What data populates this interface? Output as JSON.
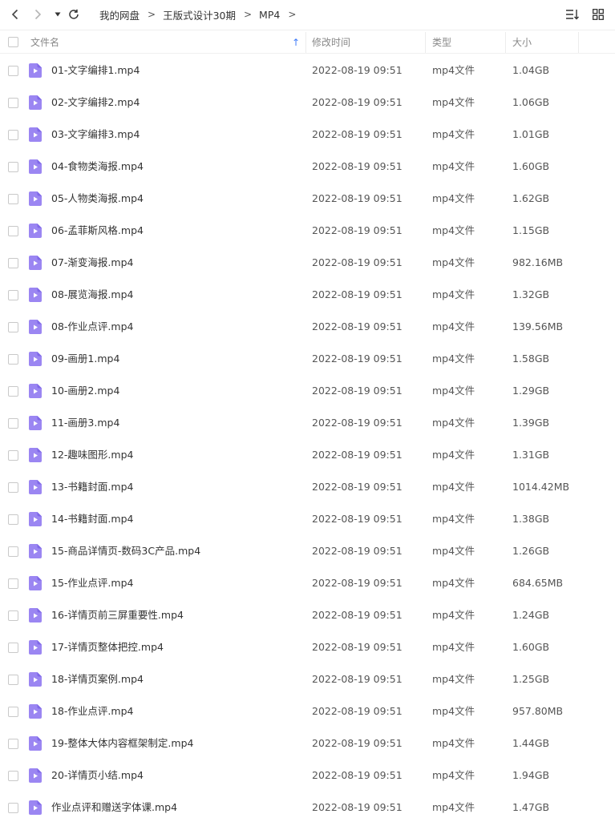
{
  "toolbar": {
    "back_icon": "chevron-left-icon",
    "forward_icon": "chevron-right-icon",
    "history_icon": "caret-down-icon",
    "refresh_icon": "refresh-icon",
    "sort_icon": "sort-list-icon",
    "view_icon": "grid-view-icon"
  },
  "breadcrumb": {
    "items": [
      "我的网盘",
      "王版式设计30期",
      "MP4"
    ],
    "separator": ">"
  },
  "columns": {
    "name": "文件名",
    "modified": "修改时间",
    "type": "类型",
    "size": "大小",
    "sort_indicator": "↑"
  },
  "colors": {
    "accent": "#3e7bfa",
    "video_icon": "#9b86f2",
    "video_icon_dark": "#7f68e8"
  },
  "files": [
    {
      "name": "01-文字编排1.mp4",
      "modified": "2022-08-19 09:51",
      "type": "mp4文件",
      "size": "1.04GB"
    },
    {
      "name": "02-文字编排2.mp4",
      "modified": "2022-08-19 09:51",
      "type": "mp4文件",
      "size": "1.06GB"
    },
    {
      "name": "03-文字编排3.mp4",
      "modified": "2022-08-19 09:51",
      "type": "mp4文件",
      "size": "1.01GB"
    },
    {
      "name": "04-食物类海报.mp4",
      "modified": "2022-08-19 09:51",
      "type": "mp4文件",
      "size": "1.60GB"
    },
    {
      "name": "05-人物类海报.mp4",
      "modified": "2022-08-19 09:51",
      "type": "mp4文件",
      "size": "1.62GB"
    },
    {
      "name": "06-孟菲斯风格.mp4",
      "modified": "2022-08-19 09:51",
      "type": "mp4文件",
      "size": "1.15GB"
    },
    {
      "name": "07-渐变海报.mp4",
      "modified": "2022-08-19 09:51",
      "type": "mp4文件",
      "size": "982.16MB"
    },
    {
      "name": "08-展览海报.mp4",
      "modified": "2022-08-19 09:51",
      "type": "mp4文件",
      "size": "1.32GB"
    },
    {
      "name": "08-作业点评.mp4",
      "modified": "2022-08-19 09:51",
      "type": "mp4文件",
      "size": "139.56MB"
    },
    {
      "name": "09-画册1.mp4",
      "modified": "2022-08-19 09:51",
      "type": "mp4文件",
      "size": "1.58GB"
    },
    {
      "name": "10-画册2.mp4",
      "modified": "2022-08-19 09:51",
      "type": "mp4文件",
      "size": "1.29GB"
    },
    {
      "name": "11-画册3.mp4",
      "modified": "2022-08-19 09:51",
      "type": "mp4文件",
      "size": "1.39GB"
    },
    {
      "name": "12-趣味图形.mp4",
      "modified": "2022-08-19 09:51",
      "type": "mp4文件",
      "size": "1.31GB"
    },
    {
      "name": "13-书籍封面.mp4",
      "modified": "2022-08-19 09:51",
      "type": "mp4文件",
      "size": "1014.42MB"
    },
    {
      "name": "14-书籍封面.mp4",
      "modified": "2022-08-19 09:51",
      "type": "mp4文件",
      "size": "1.38GB"
    },
    {
      "name": "15-商品详情页-数码3C产品.mp4",
      "modified": "2022-08-19 09:51",
      "type": "mp4文件",
      "size": "1.26GB"
    },
    {
      "name": "15-作业点评.mp4",
      "modified": "2022-08-19 09:51",
      "type": "mp4文件",
      "size": "684.65MB"
    },
    {
      "name": "16-详情页前三屏重要性.mp4",
      "modified": "2022-08-19 09:51",
      "type": "mp4文件",
      "size": "1.24GB"
    },
    {
      "name": "17-详情页整体把控.mp4",
      "modified": "2022-08-19 09:51",
      "type": "mp4文件",
      "size": "1.60GB"
    },
    {
      "name": "18-详情页案例.mp4",
      "modified": "2022-08-19 09:51",
      "type": "mp4文件",
      "size": "1.25GB"
    },
    {
      "name": "18-作业点评.mp4",
      "modified": "2022-08-19 09:51",
      "type": "mp4文件",
      "size": "957.80MB"
    },
    {
      "name": "19-整体大体内容框架制定.mp4",
      "modified": "2022-08-19 09:51",
      "type": "mp4文件",
      "size": "1.44GB"
    },
    {
      "name": "20-详情页小结.mp4",
      "modified": "2022-08-19 09:51",
      "type": "mp4文件",
      "size": "1.94GB"
    },
    {
      "name": "作业点评和赠送字体课.mp4",
      "modified": "2022-08-19 09:51",
      "type": "mp4文件",
      "size": "1.47GB"
    }
  ]
}
